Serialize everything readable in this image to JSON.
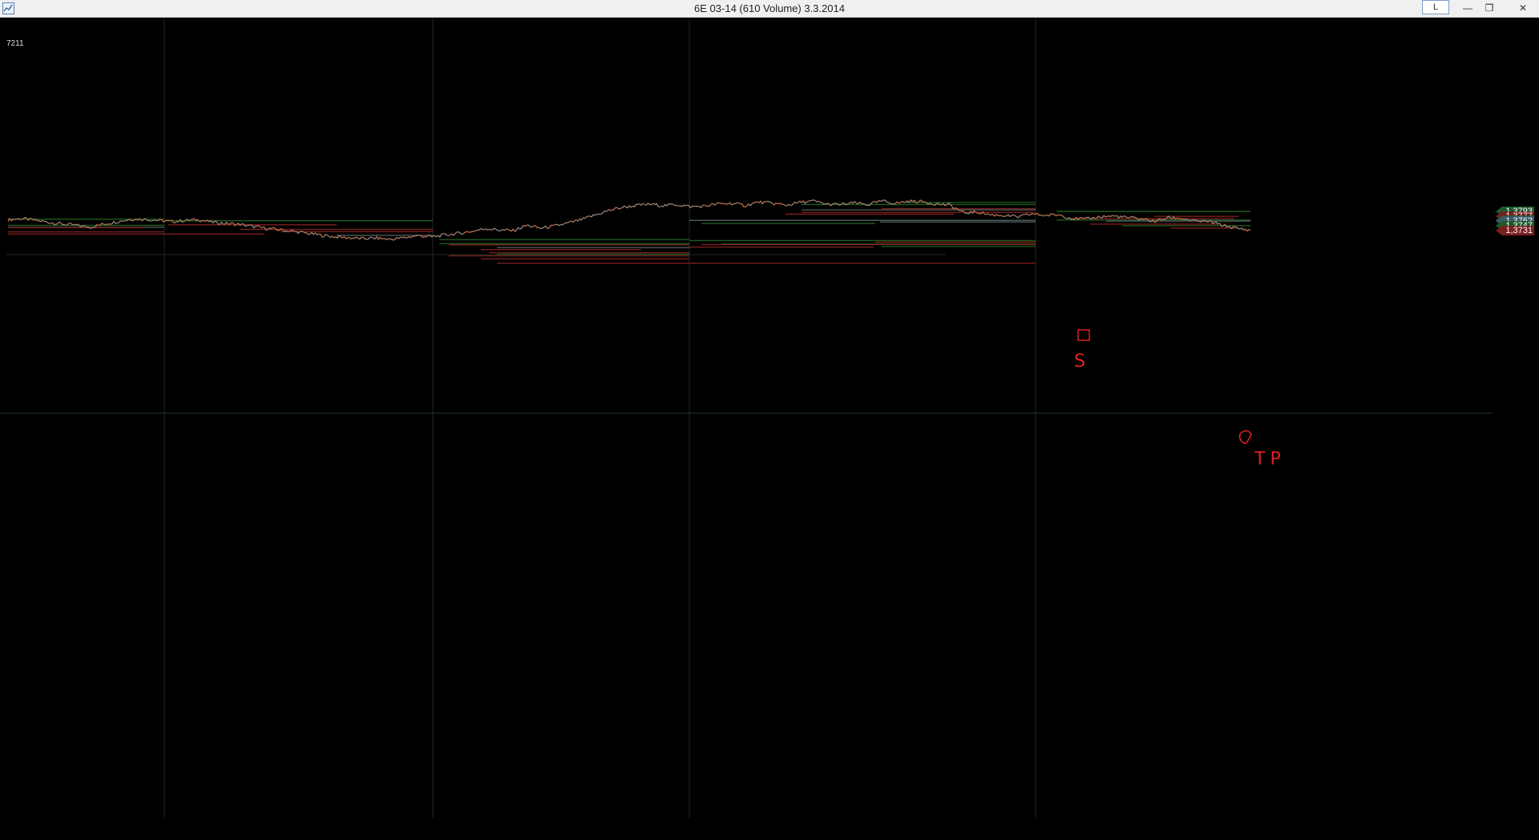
{
  "window": {
    "title": "6E 03-14 (610 Volume)  3.3.2014",
    "layout_label": "L",
    "minimize_glyph": "—",
    "restore_glyph": "❐",
    "close_glyph": "✕",
    "icon": "chart-app-icon"
  },
  "chart": {
    "bar_count": "7211",
    "background": "#000000",
    "up_color": "#c07048",
    "neutral_color": "#8a8a8a",
    "support_color": "#1e5a1e",
    "resistance_color": "#7a1e1e",
    "annotation_color": "#e02020",
    "annotations": {
      "entry_label": "S",
      "target_label": "TP"
    },
    "price_labels": [
      {
        "value": "1,3793",
        "color": "#1e5a2e"
      },
      {
        "value": "1,3777",
        "color": "#7a1e1e"
      },
      {
        "value": "1,3765",
        "color": "#1e5a2e"
      },
      {
        "value": "1,3762",
        "color": "#3a5a6a"
      },
      {
        "value": "1,3747",
        "color": "#1e5a2e"
      },
      {
        "value": "1,3731",
        "color": "#7a1e1e"
      }
    ]
  },
  "chart_data": {
    "type": "line",
    "instrument": "6E 03-14",
    "series": [
      {
        "values": [
          1.3766,
          1.377,
          1.3764,
          1.3758,
          1.3752,
          1.3748,
          1.3742,
          1.3752,
          1.376,
          1.3768,
          1.3768,
          1.3764,
          1.376,
          1.3764,
          1.3766,
          1.3758,
          1.3754,
          1.3751,
          1.3744,
          1.3738,
          1.3733,
          1.3728,
          1.3722,
          1.3716,
          1.3711,
          1.3708,
          1.3705,
          1.3707,
          1.3703,
          1.3708,
          1.3715,
          1.3711,
          1.3717,
          1.3722,
          1.3729,
          1.3738,
          1.3733,
          1.3731,
          1.3748,
          1.3739,
          1.3745,
          1.3755,
          1.3766,
          1.3781,
          1.3796,
          1.3806,
          1.3812,
          1.3816,
          1.3812,
          1.3815,
          1.3808,
          1.381,
          1.3817,
          1.3819,
          1.3812,
          1.3823,
          1.3819,
          1.3813,
          1.3822,
          1.3826,
          1.3816,
          1.3815,
          1.382,
          1.3815,
          1.3826,
          1.3819,
          1.3826,
          1.3824,
          1.3817,
          1.3813,
          1.3788,
          1.3791,
          1.3782,
          1.378,
          1.3775,
          1.3785,
          1.378,
          1.3782,
          1.377,
          1.3768,
          1.3776,
          1.3778,
          1.3773,
          1.3769,
          1.3761,
          1.3773,
          1.377,
          1.3761,
          1.376,
          1.3748,
          1.3738,
          1.3733
        ]
      }
    ],
    "visible_price_levels": [
      1.3793,
      1.3777,
      1.3765,
      1.3762,
      1.3747,
      1.3731
    ]
  }
}
